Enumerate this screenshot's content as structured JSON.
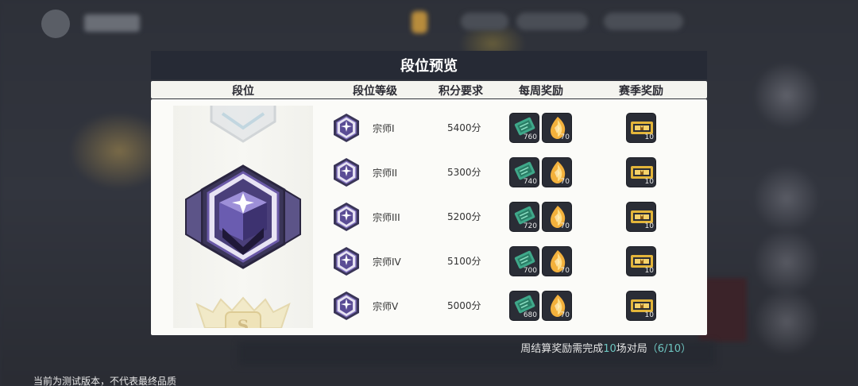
{
  "dialog": {
    "title": "段位预览",
    "headers": {
      "rank": "段位",
      "level": "段位等级",
      "points": "积分要求",
      "weekly": "每周奖励",
      "season": "赛季奖励"
    },
    "rows": [
      {
        "name": "宗师I",
        "points": "5400分",
        "weekly_ticket": "760",
        "weekly_crystal": "70",
        "season_ticket": "10"
      },
      {
        "name": "宗师II",
        "points": "5300分",
        "weekly_ticket": "740",
        "weekly_crystal": "70",
        "season_ticket": "10"
      },
      {
        "name": "宗师III",
        "points": "5200分",
        "weekly_ticket": "720",
        "weekly_crystal": "70",
        "season_ticket": "10"
      },
      {
        "name": "宗师IV",
        "points": "5100分",
        "weekly_ticket": "700",
        "weekly_crystal": "70",
        "season_ticket": "10"
      },
      {
        "name": "宗师V",
        "points": "5000分",
        "weekly_ticket": "680",
        "weekly_crystal": "70",
        "season_ticket": "10"
      }
    ]
  },
  "weekly_note": {
    "prefix": "周结算奖励需完成",
    "count": "10",
    "suffix": "场对局",
    "progress": "（6/10）"
  },
  "footer_notice": "当前为测试版本，不代表最终品质",
  "colors": {
    "title_bar": "#262a35",
    "accent_teal": "#6ec5c0",
    "badge_purple": "#6b5aa8"
  },
  "icons": {
    "rank_badge": "grandmaster-badge-icon",
    "weekly_ticket": "green-ticket-icon",
    "weekly_crystal": "gold-crystal-icon",
    "season_ticket": "gold-ticket-icon"
  }
}
